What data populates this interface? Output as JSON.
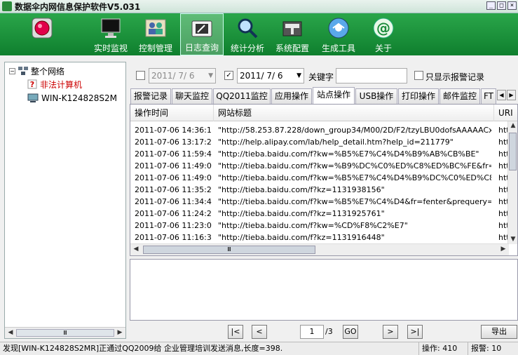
{
  "window": {
    "title": "数据伞内网信息保护软件V5.031",
    "controls": [
      "_",
      "□",
      "×"
    ]
  },
  "toolbar": {
    "items": [
      {
        "label": "",
        "icon": "record-icon"
      },
      {
        "label": "实时监视",
        "icon": "monitor-icon"
      },
      {
        "label": "控制管理",
        "icon": "users-icon"
      },
      {
        "label": "日志查询",
        "icon": "log-folder-icon",
        "active": true
      },
      {
        "label": "统计分析",
        "icon": "magnifier-icon"
      },
      {
        "label": "系统配置",
        "icon": "tools-icon"
      },
      {
        "label": "生成工具",
        "icon": "cd-icon"
      },
      {
        "label": "关于",
        "icon": "ie-icon"
      }
    ]
  },
  "tree": {
    "root": "整个网络",
    "children": [
      "非法计算机",
      "WIN-K124828S2M"
    ],
    "child_colors": [
      "#cc0000",
      "#000000"
    ]
  },
  "filter": {
    "from_date": "2011/ 7/ 6",
    "from_checked": false,
    "to_date": "2011/ 7/ 6",
    "to_checked": true,
    "keyword_label": "关键字",
    "keyword_value": "",
    "alarm_only_label": "只显示报警记录",
    "alarm_only_checked": false
  },
  "tabs": [
    "报警记录",
    "聊天监控",
    "QQ2011监控",
    "应用操作",
    "站点操作",
    "USB操作",
    "打印操作",
    "邮件监控",
    "FT"
  ],
  "active_tab": 4,
  "table": {
    "columns": [
      "操作时间",
      "网站标题",
      "URI"
    ],
    "rows": [
      [
        "2011-07-06 14:36:14",
        "\"http://58.253.87.228/down_group34/M00/2D/F2/tzyLBU0dofsAAAAACxJ5G...",
        "http"
      ],
      [
        "2011-07-06 13:17:20",
        "\"http://help.alipay.com/lab/help_detail.htm?help_id=211779\"",
        "http"
      ],
      [
        "2011-07-06 11:59:43",
        "\"http://tieba.baidu.com/f?kw=%B5%E7%C4%D4%B9%AB%CB%BE\"",
        "http"
      ],
      [
        "2011-07-06 11:49:01",
        "\"http://tieba.baidu.com/f?kw=%B9%DC%C0%ED%C8%ED%BC%FE&fr=fe...",
        "http"
      ],
      [
        "2011-07-06 11:49:00",
        "\"http://tieba.baidu.com/f?kw=%B5%E7%C4%D4%B9%DC%C0%ED%C8%...",
        "http"
      ],
      [
        "2011-07-06 11:35:28",
        "\"http://tieba.baidu.com/f?kz=1131938156\"",
        "http"
      ],
      [
        "2011-07-06 11:34:49",
        "\"http://tieba.baidu.com/f?kw=%B5%E7%C4%D4&fr=fenter&prequery=%B5...",
        "http"
      ],
      [
        "2011-07-06 11:24:23",
        "\"http://tieba.baidu.com/f?kz=1131925761\"",
        "http"
      ],
      [
        "2011-07-06 11:23:03",
        "\"http://tieba.baidu.com/f?kw=%CD%F8%C2%E7\"",
        "http"
      ],
      [
        "2011-07-06 11:16:30",
        "\"http://tieba.baidu.com/f?kz=1131916448\"",
        "http"
      ]
    ]
  },
  "pager": {
    "first": "|<",
    "prev": "<",
    "page": "1",
    "total": "/3",
    "go": "GO",
    "next": ">",
    "last": ">|",
    "export": "导出"
  },
  "status": {
    "message": "发现[WIN-K124828S2MR]正通过QQ2009给  企业管理培训发送消息,长度=398.",
    "ops": "操作: 410",
    "alarms": "报警: 10"
  }
}
